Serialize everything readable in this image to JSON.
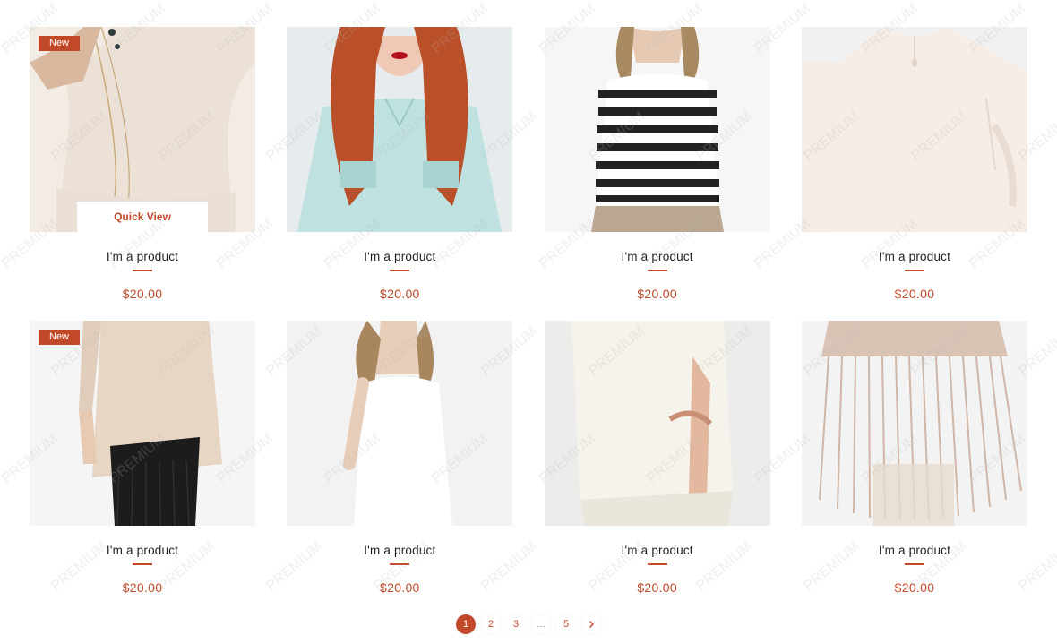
{
  "products": [
    {
      "name": "I'm a product",
      "price": "$20.00",
      "badge": "New",
      "quick_view": "Quick View",
      "img": "cream-blouse-necklace"
    },
    {
      "name": "I'm a product",
      "price": "$20.00",
      "badge": "",
      "quick_view": "",
      "img": "redhead-mint-shirt"
    },
    {
      "name": "I'm a product",
      "price": "$20.00",
      "badge": "",
      "quick_view": "",
      "img": "striped-sweater"
    },
    {
      "name": "I'm a product",
      "price": "$20.00",
      "badge": "",
      "quick_view": "",
      "img": "cream-top-back"
    },
    {
      "name": "I'm a product",
      "price": "$20.00",
      "badge": "New",
      "quick_view": "",
      "img": "beige-top-fringe-skirt"
    },
    {
      "name": "I'm a product",
      "price": "$20.00",
      "badge": "",
      "quick_view": "",
      "img": "white-sleeveless-dress"
    },
    {
      "name": "I'm a product",
      "price": "$20.00",
      "badge": "",
      "quick_view": "",
      "img": "white-tunic"
    },
    {
      "name": "I'm a product",
      "price": "$20.00",
      "badge": "",
      "quick_view": "",
      "img": "fringe-jacket"
    }
  ],
  "pagination": {
    "pages": [
      "1",
      "2",
      "3",
      "...",
      "5"
    ],
    "current": "1",
    "next_icon": "chevron-right-icon"
  },
  "watermark": "PREMIUM",
  "colors": {
    "accent": "#c1492a",
    "text": "#222222",
    "background": "#ffffff"
  }
}
